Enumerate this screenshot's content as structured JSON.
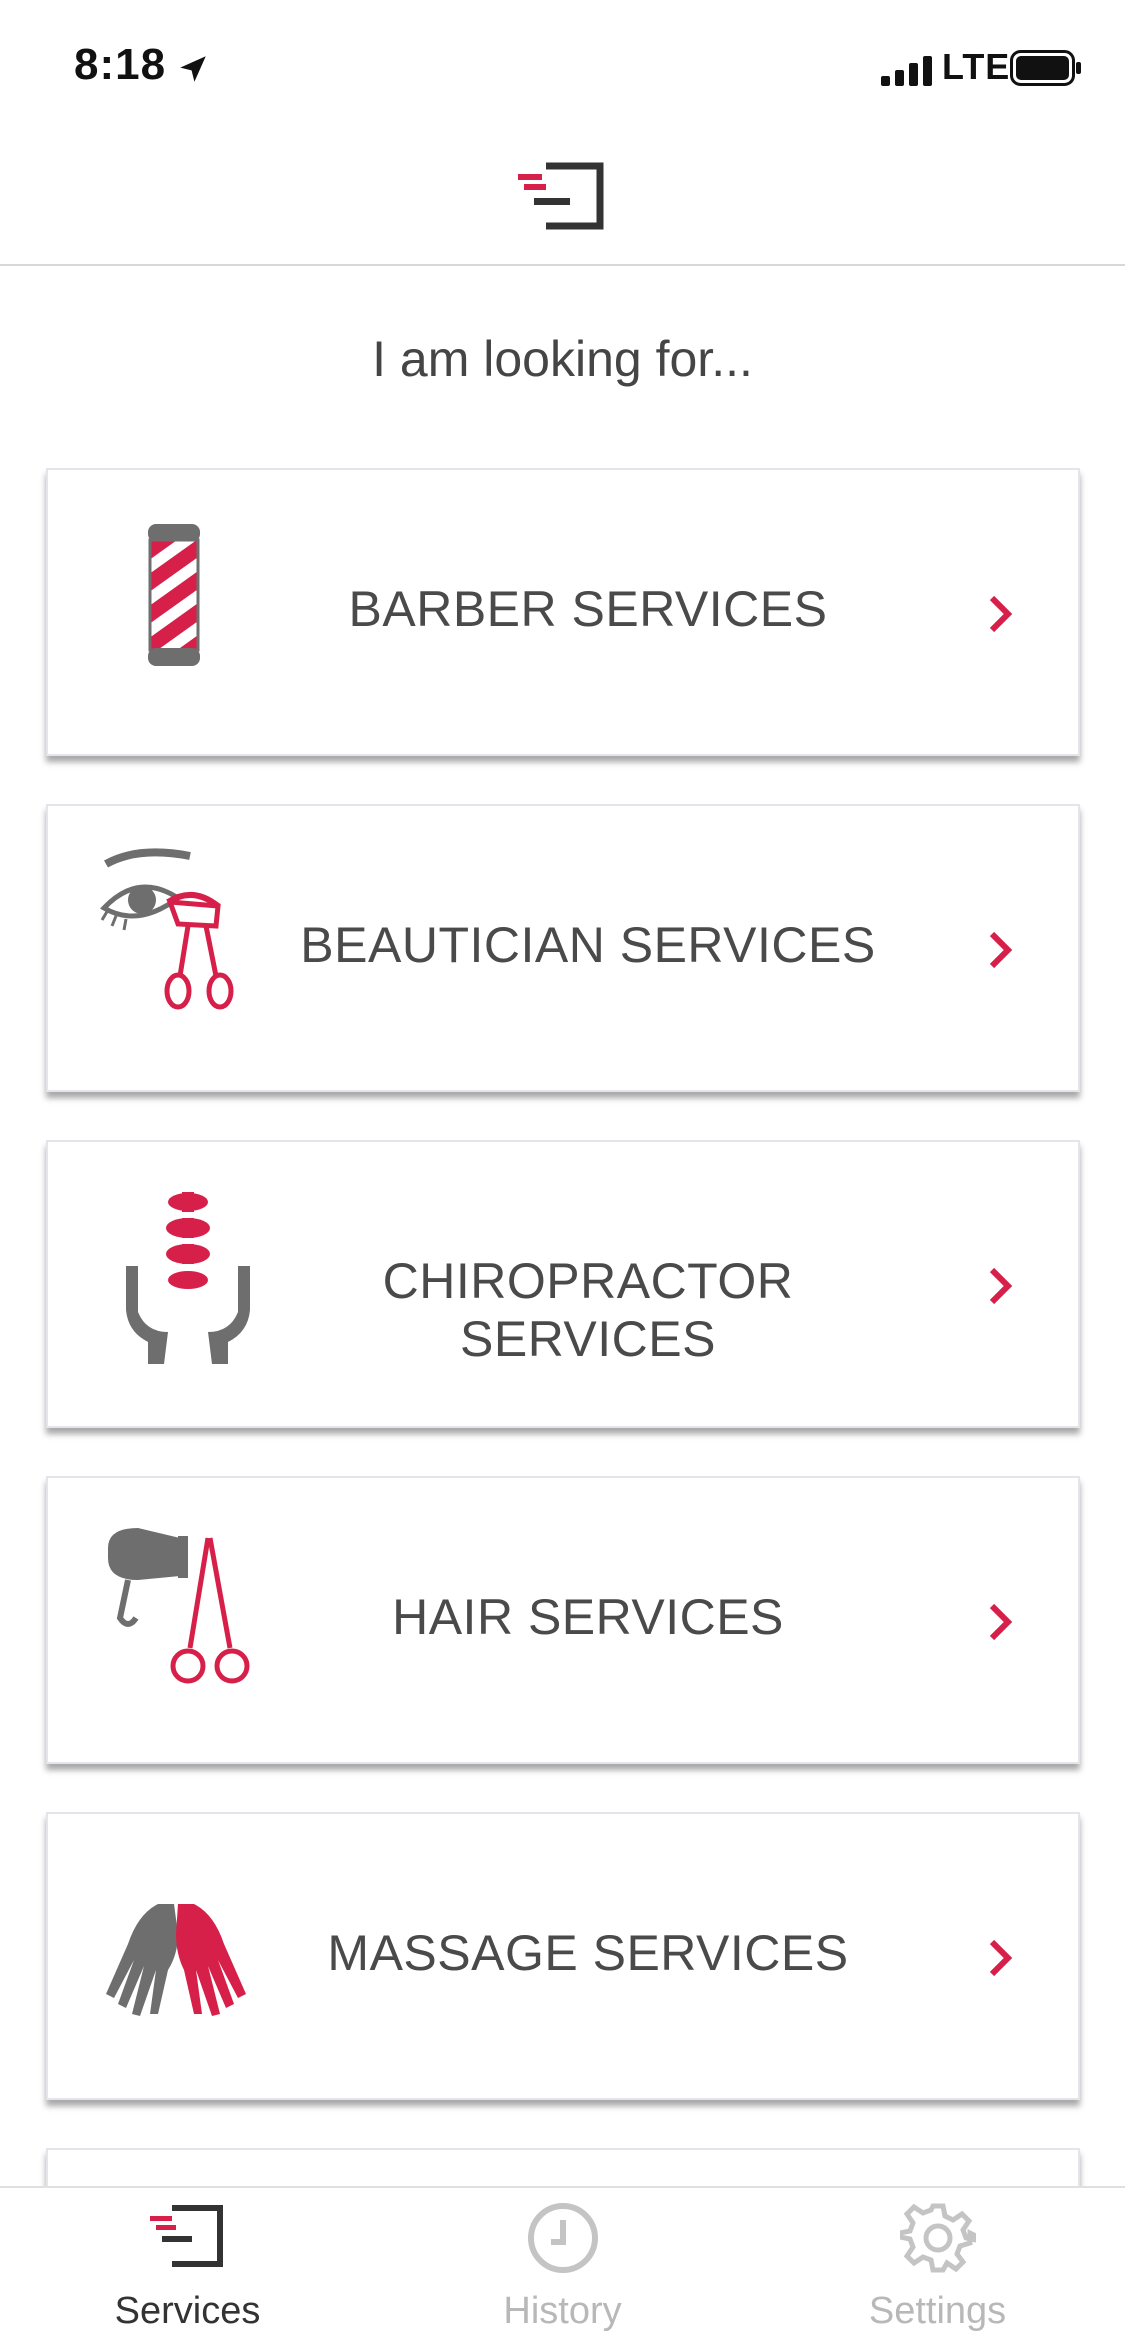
{
  "status_bar": {
    "time": "8:18",
    "network": "LTE"
  },
  "header": {
    "logo": "app-logo"
  },
  "prompt": "I am looking for...",
  "services": [
    {
      "label": "BARBER SERVICES",
      "icon": "barber-pole-icon"
    },
    {
      "label": "BEAUTICIAN SERVICES",
      "icon": "eye-lash-curler-icon"
    },
    {
      "label": "CHIROPRACTOR SERVICES",
      "icon": "spine-hands-icon"
    },
    {
      "label": "HAIR SERVICES",
      "icon": "hairdryer-scissors-icon"
    },
    {
      "label": "MASSAGE SERVICES",
      "icon": "hands-icon"
    }
  ],
  "tabs": [
    {
      "label": "Services",
      "icon": "services-icon",
      "active": true
    },
    {
      "label": "History",
      "icon": "clock-icon",
      "active": false
    },
    {
      "label": "Settings",
      "icon": "gear-icon",
      "active": false
    }
  ],
  "colors": {
    "accent": "#d6204a",
    "icon_gray": "#6e6e6e",
    "text": "#4a4a4a"
  }
}
